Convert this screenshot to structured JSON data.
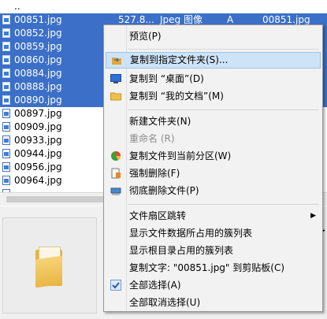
{
  "file_list": {
    "parent_entry": "..",
    "rows": [
      {
        "name": "00851.jpg",
        "size": "527.8...",
        "type": "Jpeg 图像",
        "attr": "A",
        "short": "00851.jpg",
        "selected": true
      },
      {
        "name": "00852.jpg",
        "selected": true
      },
      {
        "name": "00859.jpg",
        "selected": true
      },
      {
        "name": "00860.jpg",
        "selected": true
      },
      {
        "name": "00884.jpg",
        "selected": true
      },
      {
        "name": "00888.jpg",
        "selected": true
      },
      {
        "name": "00890.jpg",
        "selected": true
      },
      {
        "name": "00897.jpg",
        "selected": false
      },
      {
        "name": "00909.jpg",
        "selected": false
      },
      {
        "name": "00933.jpg",
        "selected": false
      },
      {
        "name": "00944.jpg",
        "selected": false
      },
      {
        "name": "00956.jpg",
        "selected": false
      },
      {
        "name": "00964.jpg",
        "selected": false
      }
    ]
  },
  "context_menu": {
    "preview": "预览(P)",
    "copy_to_folder": "复制到指定文件夹(S)...",
    "copy_to_desktop": "复制到 “桌面”(D)",
    "copy_to_documents": "复制到 “我的文档”(M)",
    "new_folder": "新建文件夹(N)",
    "rename": "重命名 (R)",
    "copy_to_partition": "复制文件到当前分区(W)",
    "force_delete": "强制删除(F)",
    "wipe_delete": "彻底删除文件(P)",
    "sector_jump": "文件扇区跳转",
    "show_cluster_list": "显示文件数据所占用的簇列表",
    "show_root_cluster": "显示根目录占用的簇列表",
    "copy_text": "复制文字: \"00851.jpg\" 到剪贴板(C)",
    "select_all": "全部选择(A)",
    "deselect_all": "全部取消选择(U)"
  },
  "colors": {
    "selection": "#3b6fc8",
    "menu_highlight": "#cfe3f7"
  }
}
